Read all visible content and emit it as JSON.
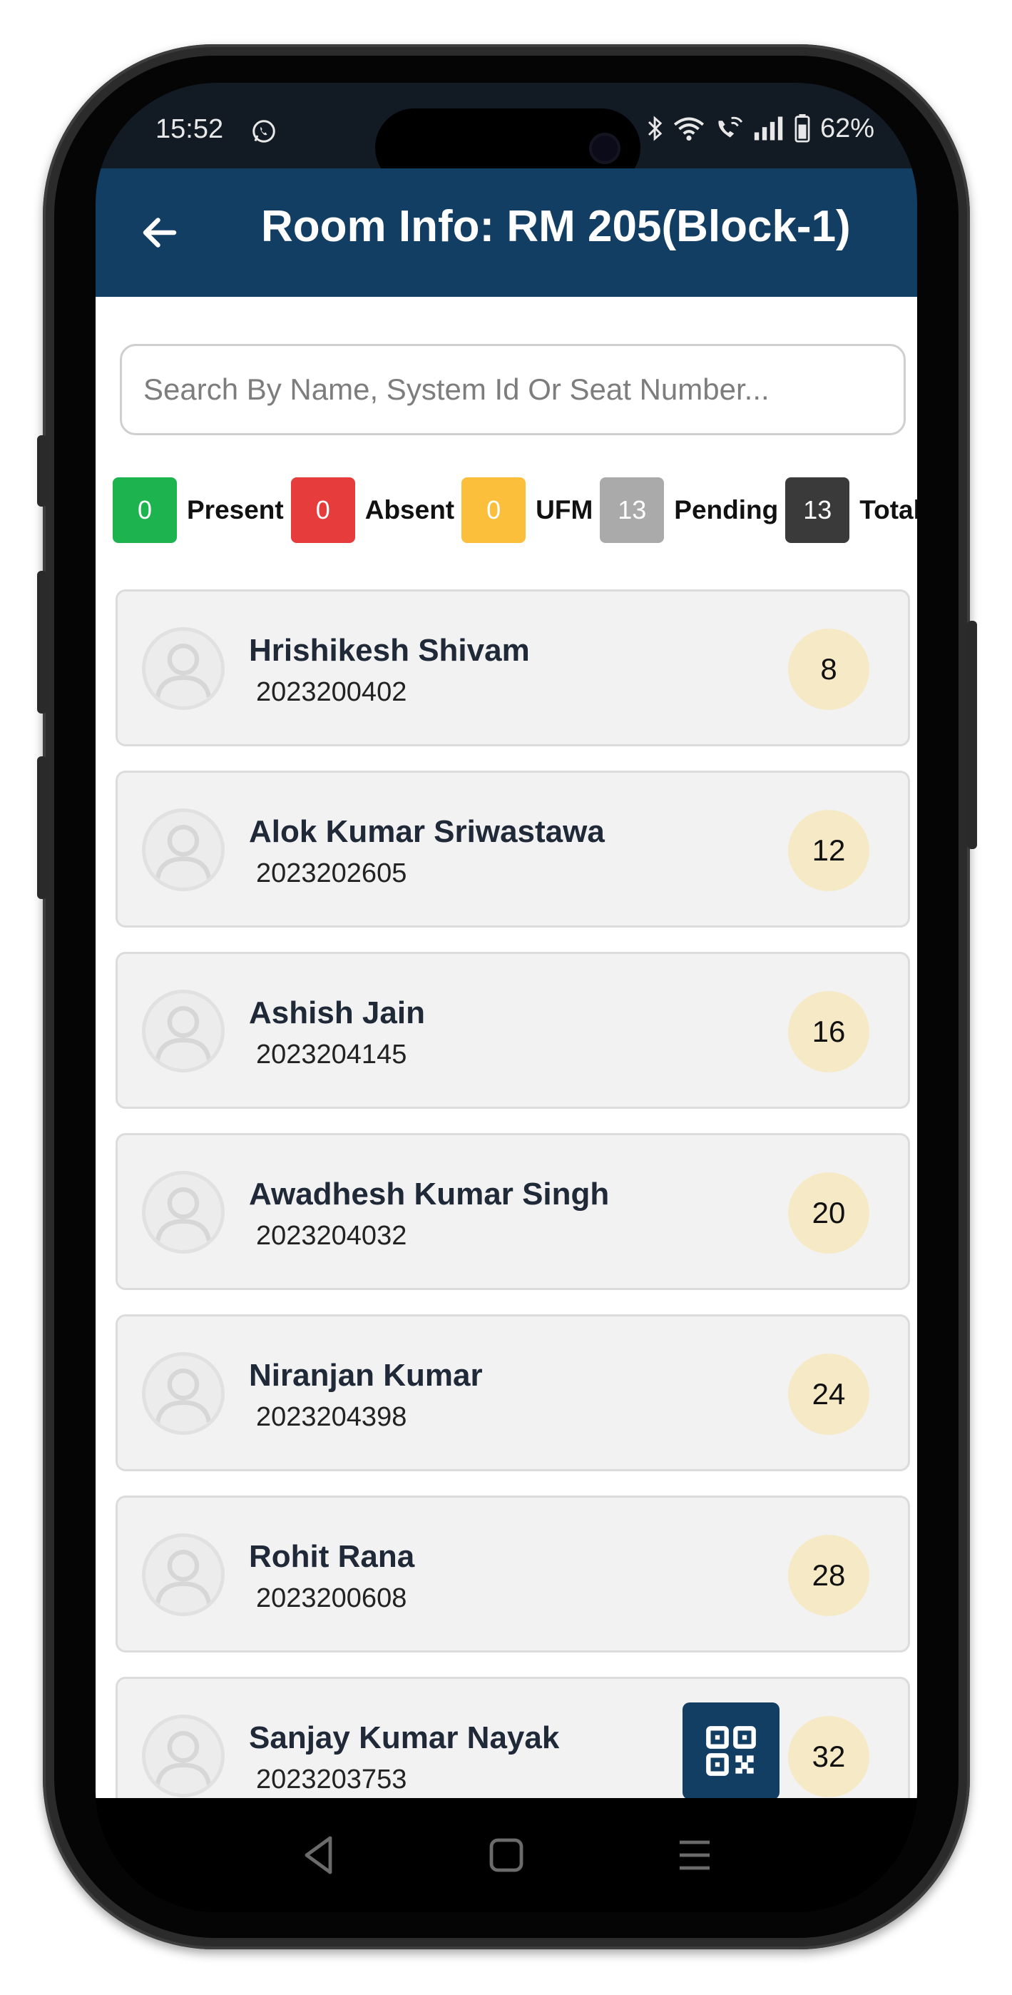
{
  "status_bar": {
    "time": "15:52",
    "battery": "62%",
    "icons": [
      "whatsapp-icon",
      "bluetooth-icon",
      "wifi-icon",
      "wifi-call-icon",
      "signal-icon",
      "battery-icon"
    ]
  },
  "app_bar": {
    "title": "Room Info: RM 205(Block-1)",
    "back_icon": "arrow-left-icon",
    "background": "#133e63"
  },
  "search": {
    "placeholder": "Search By Name, System Id Or Seat Number...",
    "value": ""
  },
  "legend": [
    {
      "count": "0",
      "label": "Present",
      "color": "#1db34f"
    },
    {
      "count": "0",
      "label": "Absent",
      "color": "#e63c3c"
    },
    {
      "count": "0",
      "label": "UFM",
      "color": "#fbbf3c"
    },
    {
      "count": "13",
      "label": "Pending",
      "color": "#aaaaaa"
    },
    {
      "count": "13",
      "label": "Total",
      "color": "#3a3a3a"
    }
  ],
  "students": [
    {
      "name": "Hrishikesh Shivam",
      "system_id": "2023200402",
      "seat": "8"
    },
    {
      "name": "Alok Kumar Sriwastawa",
      "system_id": "2023202605",
      "seat": "12"
    },
    {
      "name": "Ashish Jain",
      "system_id": "2023204145",
      "seat": "16"
    },
    {
      "name": "Awadhesh Kumar Singh",
      "system_id": "2023204032",
      "seat": "20"
    },
    {
      "name": "Niranjan Kumar",
      "system_id": "2023204398",
      "seat": "24"
    },
    {
      "name": "Rohit Rana",
      "system_id": "2023200608",
      "seat": "28"
    },
    {
      "name": "Sanjay Kumar Nayak",
      "system_id": "2023203753",
      "seat": "32"
    }
  ],
  "fab": {
    "icon": "qr-code-icon"
  },
  "nav": {
    "buttons": [
      "back-triangle-icon",
      "home-square-icon",
      "menu-lines-icon"
    ]
  }
}
